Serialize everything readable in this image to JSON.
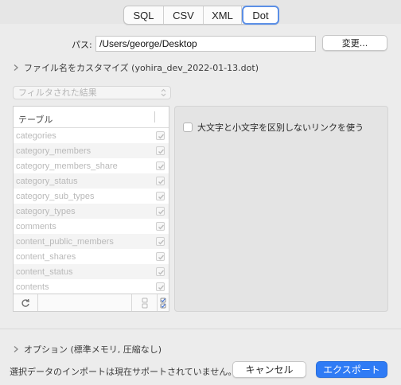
{
  "format_tabs": [
    {
      "label": "SQL",
      "selected": false
    },
    {
      "label": "CSV",
      "selected": false
    },
    {
      "label": "XML",
      "selected": false
    },
    {
      "label": "Dot",
      "selected": true
    }
  ],
  "path": {
    "label": "パス:",
    "value": "/Users/george/Desktop",
    "change_button": "変更..."
  },
  "filename_disclosure": {
    "label": "ファイル名をカスタマイズ (yohira_dev_2022-01-13.dot)",
    "expanded": false
  },
  "filter": {
    "selected": "フィルタされた結果",
    "enabled": false
  },
  "table": {
    "header": "テーブル",
    "rows": [
      {
        "name": "categories",
        "checked": true
      },
      {
        "name": "category_members",
        "checked": true
      },
      {
        "name": "category_members_share",
        "checked": true
      },
      {
        "name": "category_status",
        "checked": true
      },
      {
        "name": "category_sub_types",
        "checked": true
      },
      {
        "name": "category_types",
        "checked": true
      },
      {
        "name": "comments",
        "checked": true
      },
      {
        "name": "content_public_members",
        "checked": true
      },
      {
        "name": "content_shares",
        "checked": true
      },
      {
        "name": "content_status",
        "checked": true
      },
      {
        "name": "contents",
        "checked": true
      }
    ],
    "footer_icons": [
      "refresh-icon",
      "select-none-icon",
      "select-all-icon"
    ]
  },
  "options_panel": {
    "case_insensitive_links_label": "大文字と小文字を区別しないリンクを使う",
    "case_insensitive_links_checked": false
  },
  "options_disclosure": {
    "label": "オプション (標準メモリ, 圧縮なし)",
    "expanded": false
  },
  "footer": {
    "status": "選択データのインポートは現在サポートされていません。",
    "cancel_label": "キャンセル",
    "export_label": "エクスポート"
  },
  "colors": {
    "accent": "#2f7bf5",
    "selected_tab_border": "#5b8fe6"
  }
}
